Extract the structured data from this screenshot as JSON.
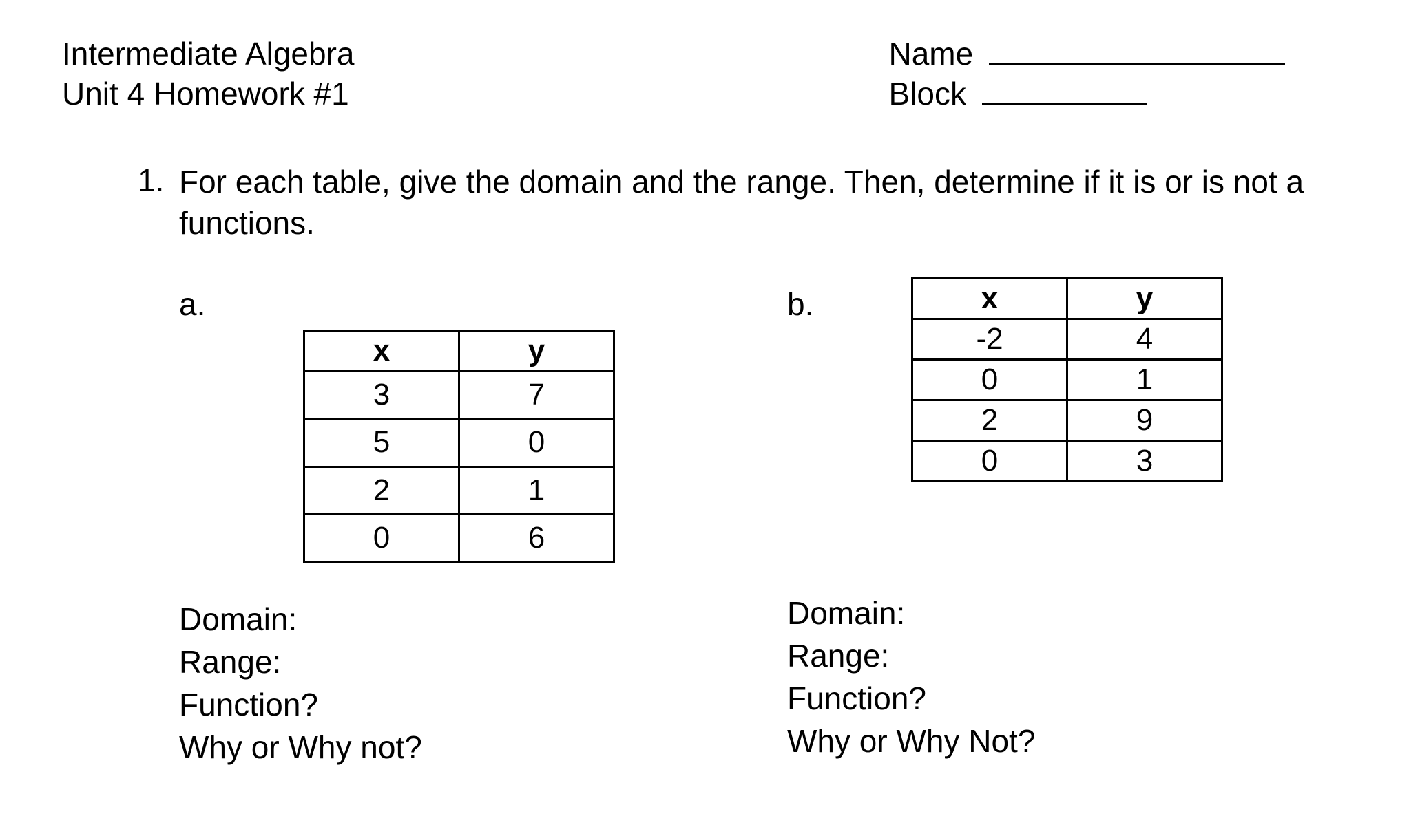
{
  "header": {
    "course_title": "Intermediate Algebra",
    "assignment": "Unit 4 Homework #1",
    "name_label": "Name",
    "block_label": "Block"
  },
  "question": {
    "number": "1.",
    "text": "For each table, give the domain and the range.  Then, determine if it is or is not a functions."
  },
  "part_a": {
    "label": "a.",
    "col_x": "x",
    "col_y": "y",
    "rows": [
      {
        "x": "3",
        "y": "7"
      },
      {
        "x": "5",
        "y": "0"
      },
      {
        "x": "2",
        "y": "1"
      },
      {
        "x": "0",
        "y": "6"
      }
    ],
    "answers": {
      "domain": "Domain:",
      "range": "Range:",
      "function": "Function?",
      "why": "Why or Why not?"
    }
  },
  "part_b": {
    "label": "b.",
    "col_x": "x",
    "col_y": "y",
    "rows": [
      {
        "x": "-2",
        "y": "4"
      },
      {
        "x": "0",
        "y": "1"
      },
      {
        "x": "2",
        "y": "9"
      },
      {
        "x": "0",
        "y": "3"
      }
    ],
    "answers": {
      "domain": "Domain:",
      "range": "Range:",
      "function": "Function?",
      "why": "Why or Why Not?"
    }
  },
  "chart_data": [
    {
      "type": "table",
      "label": "a",
      "columns": [
        "x",
        "y"
      ],
      "rows": [
        [
          3,
          7
        ],
        [
          5,
          0
        ],
        [
          2,
          1
        ],
        [
          0,
          6
        ]
      ]
    },
    {
      "type": "table",
      "label": "b",
      "columns": [
        "x",
        "y"
      ],
      "rows": [
        [
          -2,
          4
        ],
        [
          0,
          1
        ],
        [
          2,
          9
        ],
        [
          0,
          3
        ]
      ]
    }
  ]
}
